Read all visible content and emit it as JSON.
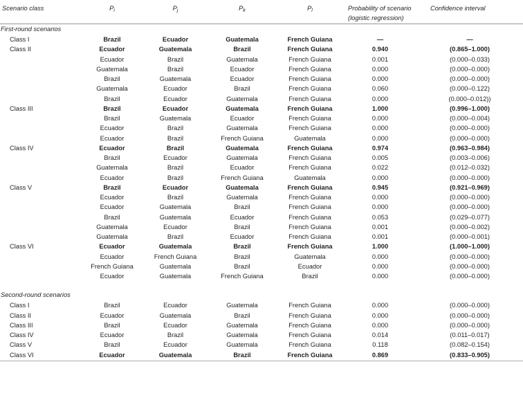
{
  "header": {
    "scenario_class": "Scenario class",
    "p_i": "P",
    "p_i_sub": "i",
    "p_j": "P",
    "p_j_sub": "j",
    "p_k": "P",
    "p_k_sub": "k",
    "p_l": "P",
    "p_l_sub": "l",
    "probability_line1": "Probability of scenario",
    "probability_line2": "(logistic regression)",
    "confidence_interval": "Confidence interval"
  },
  "sections": [
    {
      "label": "First-round scenarios",
      "rows": [
        {
          "bold": true,
          "class": "Class I",
          "pi": "Brazil",
          "pj": "Ecuador",
          "pk": "Guatemala",
          "pl": "French Guiana",
          "prob": "—",
          "ci": "—"
        },
        {
          "bold": true,
          "class": "Class II",
          "pi": "Ecuador",
          "pj": "Guatemala",
          "pk": "Brazil",
          "pl": "French Guiana",
          "prob": "0.940",
          "ci": "(0.865–1.000)"
        },
        {
          "bold": false,
          "class": "",
          "pi": "Ecuador",
          "pj": "Brazil",
          "pk": "Guatemala",
          "pl": "French Guiana",
          "prob": "0.001",
          "ci": "(0.000–0.033)"
        },
        {
          "bold": false,
          "class": "",
          "pi": "Guatemala",
          "pj": "Brazil",
          "pk": "Ecuador",
          "pl": "French Guiana",
          "prob": "0.000",
          "ci": "(0.000–0.000)"
        },
        {
          "bold": false,
          "class": "",
          "pi": "Brazil",
          "pj": "Guatemala",
          "pk": "Ecuador",
          "pl": "French Guiana",
          "prob": "0.000",
          "ci": "(0.000–0.000)"
        },
        {
          "bold": false,
          "class": "",
          "pi": "Guatemala",
          "pj": "Ecuador",
          "pk": "Brazil",
          "pl": "French Guiana",
          "prob": "0.060",
          "ci": "(0.000–0.122)"
        },
        {
          "bold": false,
          "class": "",
          "pi": "Brazil",
          "pj": "Ecuador",
          "pk": "Guatemala",
          "pl": "French Guiana",
          "prob": "0.000",
          "ci": "(0.000–0.012))"
        },
        {
          "bold": true,
          "class": "Class III",
          "pi": "Brazil",
          "pj": "Ecuador",
          "pk": "Guatemala",
          "pl": "French Guiana",
          "prob": "1.000",
          "ci": "(0.996–1.000)"
        },
        {
          "bold": false,
          "class": "",
          "pi": "Brazil",
          "pj": "Guatemala",
          "pk": "Ecuador",
          "pl": "French Guiana",
          "prob": "0.000",
          "ci": "(0.000–0.004)"
        },
        {
          "bold": false,
          "class": "",
          "pi": "Ecuador",
          "pj": "Brazil",
          "pk": "Guatemala",
          "pl": "French Guiana",
          "prob": "0.000",
          "ci": "(0.000–0.000)"
        },
        {
          "bold": false,
          "class": "",
          "pi": "Ecuador",
          "pj": "Brazil",
          "pk": "French Guiana",
          "pl": "Guatemala",
          "prob": "0.000",
          "ci": "(0.000–0.000)"
        },
        {
          "bold": true,
          "class": "Class IV",
          "pi": "Ecuador",
          "pj": "Brazil",
          "pk": "Guatemala",
          "pl": "French Guiana",
          "prob": "0.974",
          "ci": "(0.963–0.984)"
        },
        {
          "bold": false,
          "class": "",
          "pi": "Brazil",
          "pj": "Ecuador",
          "pk": "Guatemala",
          "pl": "French Guiana",
          "prob": "0.005",
          "ci": "(0.003–0.006)"
        },
        {
          "bold": false,
          "class": "",
          "pi": "Guatemala",
          "pj": "Brazil",
          "pk": "Ecuador",
          "pl": "French Guiana",
          "prob": "0.022",
          "ci": "(0.012–0.032)"
        },
        {
          "bold": false,
          "class": "",
          "pi": "Ecuador",
          "pj": "Brazil",
          "pk": "French Guiana",
          "pl": "Guatemala",
          "prob": "0.000",
          "ci": "(0.000–0.000)"
        },
        {
          "bold": true,
          "class": "Class V",
          "pi": "Brazil",
          "pj": "Ecuador",
          "pk": "Guatemala",
          "pl": "French Guiana",
          "prob": "0.945",
          "ci": "(0.921–0.969)"
        },
        {
          "bold": false,
          "class": "",
          "pi": "Ecuador",
          "pj": "Brazil",
          "pk": "Guatemala",
          "pl": "French Guiana",
          "prob": "0.000",
          "ci": "(0.000–0.000)"
        },
        {
          "bold": false,
          "class": "",
          "pi": "Ecuador",
          "pj": "Guatemala",
          "pk": "Brazil",
          "pl": "French Guiana",
          "prob": "0.000",
          "ci": "(0.000–0.000)"
        },
        {
          "bold": false,
          "class": "",
          "pi": "Brazil",
          "pj": "Guatemala",
          "pk": "Ecuador",
          "pl": "French Guiana",
          "prob": "0.053",
          "ci": "(0.029–0.077)"
        },
        {
          "bold": false,
          "class": "",
          "pi": "Guatemala",
          "pj": "Ecuador",
          "pk": "Brazil",
          "pl": "French Guiana",
          "prob": "0.001",
          "ci": "(0.000–0.002)"
        },
        {
          "bold": false,
          "class": "",
          "pi": "Guatemala",
          "pj": "Brazil",
          "pk": "Ecuador",
          "pl": "French Guiana",
          "prob": "0.001",
          "ci": "(0.000–0.001)"
        },
        {
          "bold": true,
          "class": "Class VI",
          "pi": "Ecuador",
          "pj": "Guatemala",
          "pk": "Brazil",
          "pl": "French Guiana",
          "prob": "1.000",
          "ci": "(1.000–1.000)"
        },
        {
          "bold": false,
          "class": "",
          "pi": "Ecuador",
          "pj": "French Guiana",
          "pk": "Brazil",
          "pl": "Guatemala",
          "prob": "0.000",
          "ci": "(0.000–0.000)"
        },
        {
          "bold": false,
          "class": "",
          "pi": "French Guiana",
          "pj": "Guatemala",
          "pk": "Brazil",
          "pl": "Ecuador",
          "prob": "0.000",
          "ci": "(0.000–0.000)"
        },
        {
          "bold": false,
          "class": "",
          "pi": "Ecuador",
          "pj": "Guatemala",
          "pk": "French Guiana",
          "pl": "Brazil",
          "prob": "0.000",
          "ci": "(0.000–0.000)"
        }
      ]
    },
    {
      "label": "Second-round scenarios",
      "rows": [
        {
          "bold": false,
          "class": "Class I",
          "pi": "Brazil",
          "pj": "Ecuador",
          "pk": "Guatemala",
          "pl": "French Guiana",
          "prob": "0.000",
          "ci": "(0.000–0.000)"
        },
        {
          "bold": false,
          "class": "Class II",
          "pi": "Ecuador",
          "pj": "Guatemala",
          "pk": "Brazil",
          "pl": "French Guiana",
          "prob": "0.000",
          "ci": "(0.000–0.000)"
        },
        {
          "bold": false,
          "class": "Class III",
          "pi": "Brazil",
          "pj": "Ecuador",
          "pk": "Guatemala",
          "pl": "French Guiana",
          "prob": "0.000",
          "ci": "(0.000–0.000)"
        },
        {
          "bold": false,
          "class": "Class IV",
          "pi": "Ecuador",
          "pj": "Brazil",
          "pk": "Guatemala",
          "pl": "French Guiana",
          "prob": "0.014",
          "ci": "(0.011–0.017)"
        },
        {
          "bold": false,
          "class": "Class V",
          "pi": "Brazil",
          "pj": "Ecuador",
          "pk": "Guatemala",
          "pl": "French Guiana",
          "prob": "0.118",
          "ci": "(0.082–0.154)"
        },
        {
          "bold": true,
          "class": "Class VI",
          "pi": "Ecuador",
          "pj": "Guatemala",
          "pk": "Brazil",
          "pl": "French Guiana",
          "prob": "0.869",
          "ci": "(0.833–0.905)"
        }
      ]
    }
  ]
}
